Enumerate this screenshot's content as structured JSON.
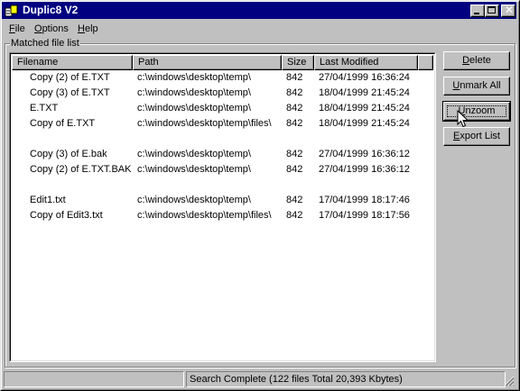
{
  "app": {
    "title": "Duplic8 V2"
  },
  "menu": [
    {
      "acc": "F",
      "rest": "ile"
    },
    {
      "acc": "O",
      "rest": "ptions"
    },
    {
      "acc": "H",
      "rest": "elp"
    }
  ],
  "group": {
    "label": "Matched file list"
  },
  "columns": {
    "filename": "Filename",
    "path": "Path",
    "size": "Size",
    "modified": "Last Modified"
  },
  "rows": [
    {
      "filename": "Copy (2) of E.TXT",
      "path": "c:\\windows\\desktop\\temp\\",
      "size": "842",
      "modified": "27/04/1999 16:36:24"
    },
    {
      "filename": "Copy (3) of E.TXT",
      "path": "c:\\windows\\desktop\\temp\\",
      "size": "842",
      "modified": "18/04/1999 21:45:24"
    },
    {
      "filename": "E.TXT",
      "path": "c:\\windows\\desktop\\temp\\",
      "size": "842",
      "modified": "18/04/1999 21:45:24"
    },
    {
      "filename": "Copy of E.TXT",
      "path": "c:\\windows\\desktop\\temp\\files\\",
      "size": "842",
      "modified": "18/04/1999 21:45:24"
    },
    {
      "filename": "Copy (3) of E.bak",
      "path": "c:\\windows\\desktop\\temp\\",
      "size": "842",
      "modified": "27/04/1999 16:36:12"
    },
    {
      "filename": "Copy (2) of E.TXT.BAK",
      "path": "c:\\windows\\desktop\\temp\\",
      "size": "842",
      "modified": "27/04/1999 16:36:12"
    },
    {
      "filename": "Edit1.txt",
      "path": "c:\\windows\\desktop\\temp\\",
      "size": "842",
      "modified": "17/04/1999 18:17:46"
    },
    {
      "filename": "Copy of Edit3.txt",
      "path": "c:\\windows\\desktop\\temp\\files\\",
      "size": "842",
      "modified": "17/04/1999 18:17:56"
    }
  ],
  "buttons": {
    "delete": {
      "acc": "D",
      "rest": "elete"
    },
    "unmark_all": {
      "acc": "U",
      "rest": "nmark All"
    },
    "unzoom": {
      "acc": "U",
      "rest": "nzoom"
    },
    "export_list": {
      "acc": "E",
      "rest": "xport List"
    }
  },
  "status": {
    "panel1": "",
    "panel2": "Search Complete (122 files  Total 20,393 Kbytes)"
  },
  "icons": {
    "app": "app-icon",
    "cursor": "mouse-pointer-icon"
  }
}
